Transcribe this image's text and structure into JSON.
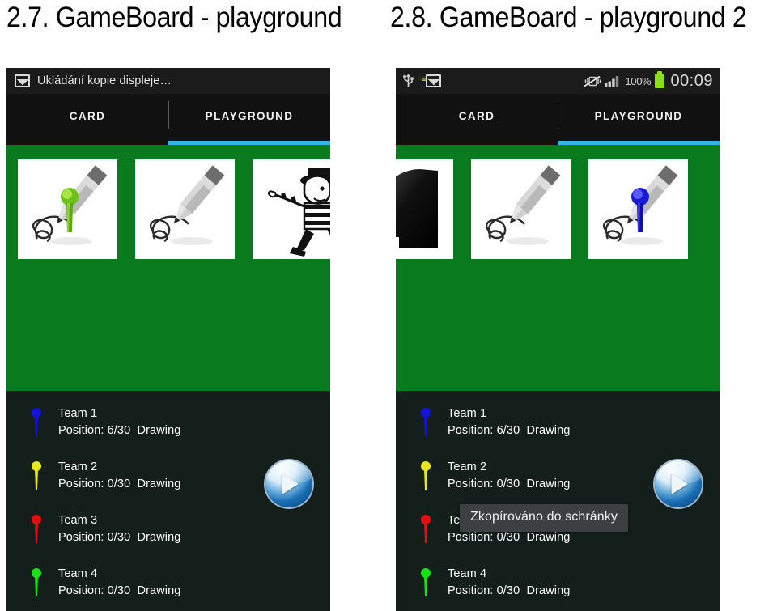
{
  "figures": {
    "left_caption": "2.7. GameBoard - playground",
    "right_caption": "2.8. GameBoard - playground 2"
  },
  "left_screenshot": {
    "statusbar": {
      "type": "notification",
      "icon": "gallery-icon",
      "text": "Ukládání kopie displeje…"
    },
    "tabs": [
      {
        "label": "CARD",
        "active": false
      },
      {
        "label": "PLAYGROUND",
        "active": true
      }
    ],
    "board": {
      "background_color": "#0a7a1e",
      "cards": [
        {
          "art": "pencil-with-green-pin"
        },
        {
          "art": "pencil"
        },
        {
          "art": "burglar"
        }
      ]
    },
    "teams": [
      {
        "pin_color": "#1414d8",
        "name": "Team 1",
        "position": "Position: 6/30",
        "state": "Drawing"
      },
      {
        "pin_color": "#e8e81a",
        "name": "Team 2",
        "position": "Position: 0/30",
        "state": "Drawing"
      },
      {
        "pin_color": "#e01010",
        "name": "Team 3",
        "position": "Position: 0/30",
        "state": "Drawing"
      },
      {
        "pin_color": "#19e019",
        "name": "Team 4",
        "position": "Position: 0/30",
        "state": "Drawing"
      }
    ],
    "play_button": {
      "icon": "play-icon",
      "label": ""
    }
  },
  "right_screenshot": {
    "statusbar": {
      "type": "icons",
      "left_icons": [
        "usb-icon",
        "battery-icon",
        "gallery-icon"
      ],
      "battery_small_label": "100%",
      "right_icons": [
        "vibrate-off-icon",
        "signal-icon"
      ],
      "battery_percent": "100%",
      "clock": "00:09"
    },
    "tabs": [
      {
        "label": "CARD",
        "active": false
      },
      {
        "label": "PLAYGROUND",
        "active": true
      }
    ],
    "board": {
      "background_color": "#0a7a1e",
      "cards": [
        {
          "art": "head-silhouette"
        },
        {
          "art": "pencil"
        },
        {
          "art": "pencil-with-blue-pin"
        }
      ]
    },
    "teams": [
      {
        "pin_color": "#1414d8",
        "name": "Team 1",
        "position": "Position: 6/30",
        "state": "Drawing"
      },
      {
        "pin_color": "#e8e81a",
        "name": "Team 2",
        "position": "Position: 0/30",
        "state": "Drawing"
      },
      {
        "pin_color": "#e01010",
        "name": "Team 3",
        "position": "Position: 0/30",
        "state": "Drawing"
      },
      {
        "pin_color": "#19e019",
        "name": "Team 4",
        "position": "Position: 0/30",
        "state": "Drawing"
      }
    ],
    "play_button": {
      "icon": "play-icon",
      "label": ""
    },
    "toast": {
      "text": "Zkopírováno do schránky"
    }
  },
  "colors": {
    "board_green": "#0a7a1e",
    "panel_dark": "#141f1c",
    "tab_accent": "#33b5e5",
    "statusbar": "#1b1b1b"
  }
}
